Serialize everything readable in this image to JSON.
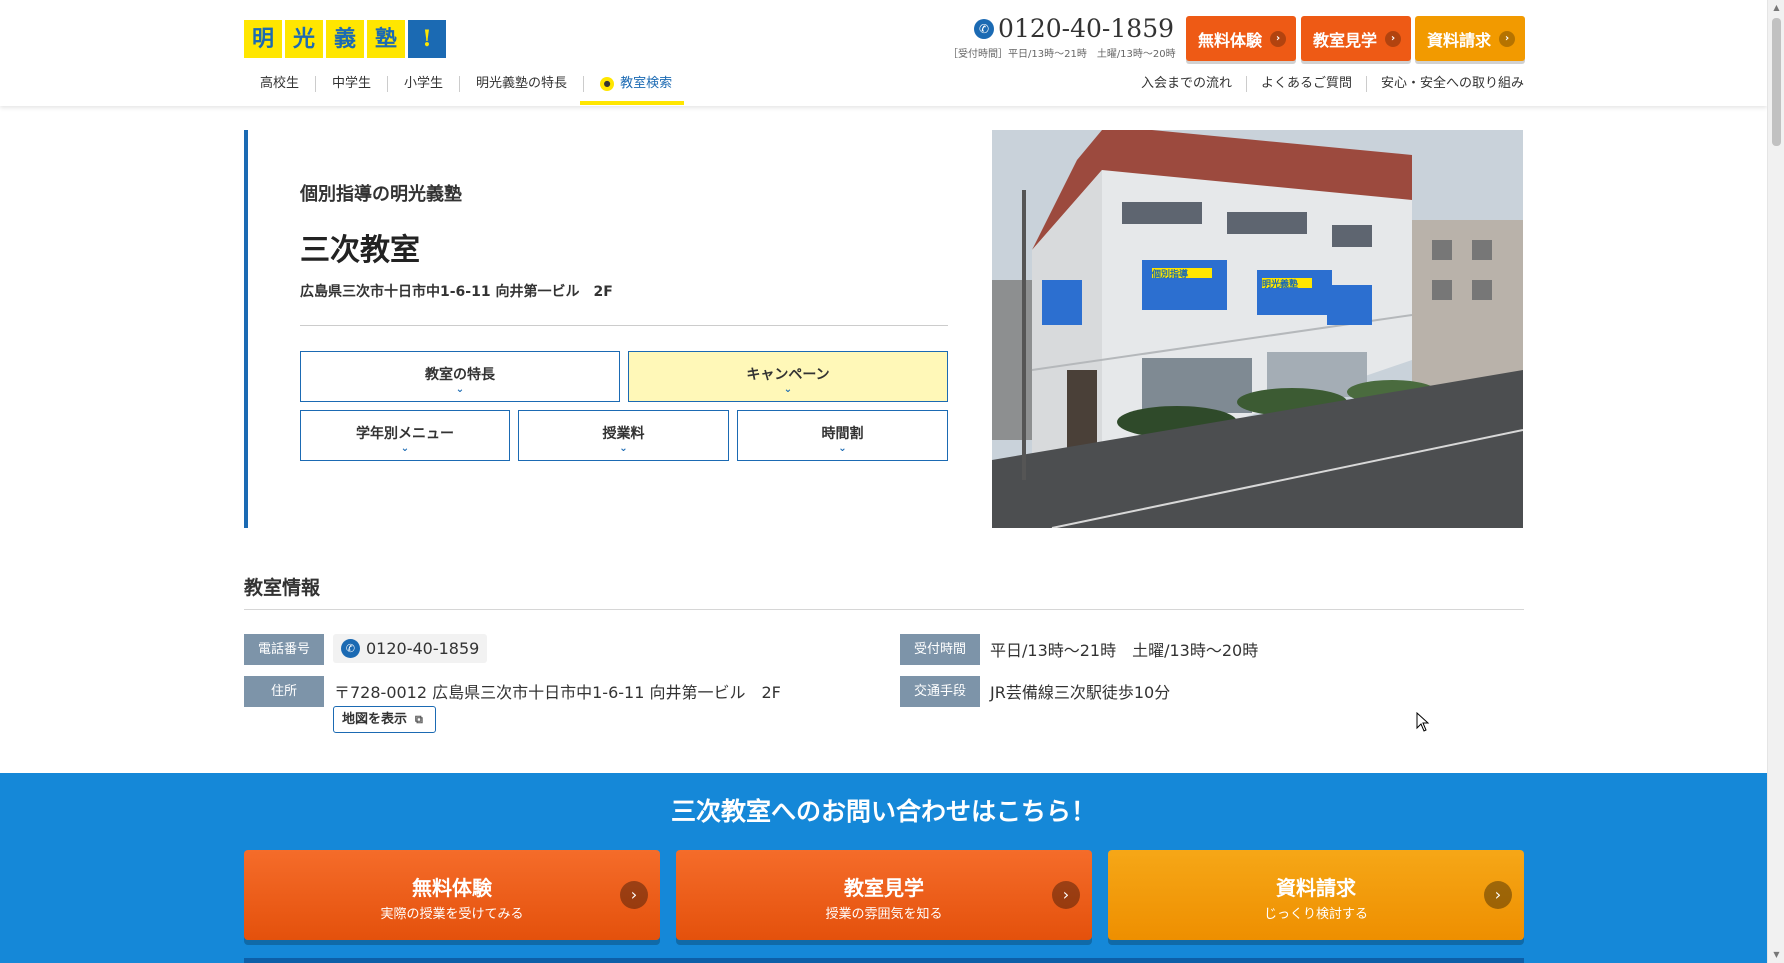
{
  "colors": {
    "brand_blue": "#1b6ab3",
    "brand_yellow": "#ffe600",
    "orange": "#ee5a15",
    "amber": "#f29a00",
    "cta_bg": "#1588d8",
    "label_bg": "#7d94a9"
  },
  "header": {
    "logo_chars": [
      "明",
      "光",
      "義",
      "塾",
      "!"
    ],
    "phone": "0120-40-1859",
    "hours": "［受付時間］平日/13時～21時　土曜/13時～20時",
    "buttons": {
      "trial": "無料体験",
      "visit": "教室見学",
      "docs": "資料請求"
    },
    "nav_left": [
      "高校生",
      "中学生",
      "小学生",
      "明光義塾の特長",
      "教室検索"
    ],
    "nav_right": [
      "入会までの流れ",
      "よくあるご質問",
      "安心・安全への取り組み"
    ]
  },
  "hero": {
    "kicker": "個別指導の明光義塾",
    "title": "三次教室",
    "address": "広島県三次市十日市中1-6-11 向井第一ビル　2F",
    "tabs": {
      "features": "教室の特長",
      "campaign": "キャンペーン",
      "grade_menu": "学年別メニュー",
      "fee": "授業料",
      "timetable": "時間割"
    }
  },
  "info": {
    "title": "教室情報",
    "phone_label": "電話番号",
    "phone_value": "0120-40-1859",
    "hours_label": "受付時間",
    "hours_value": "平日/13時～21時　土曜/13時～20時",
    "address_label": "住所",
    "address_value": "〒728-0012 広島県三次市十日市中1-6-11 向井第一ビル　2F",
    "map_button": "地図を表示",
    "access_label": "交通手段",
    "access_value": "JR芸備線三次駅徒歩10分"
  },
  "cta": {
    "title": "三次教室へのお問い合わせはこちら！",
    "buttons": [
      {
        "main": "無料体験",
        "sub": "実際の授業を受けてみる"
      },
      {
        "main": "教室見学",
        "sub": "授業の雰囲気を知る"
      },
      {
        "main": "資料請求",
        "sub": "じっくり検討する"
      }
    ]
  },
  "photo_signs": {
    "sign_a": "個別指導",
    "sign_b": "明光義塾"
  },
  "icons": [
    "phone-icon",
    "chevron-right-icon",
    "chevron-down-icon",
    "search-icon",
    "external-link-icon",
    "mouse-cursor-icon"
  ]
}
